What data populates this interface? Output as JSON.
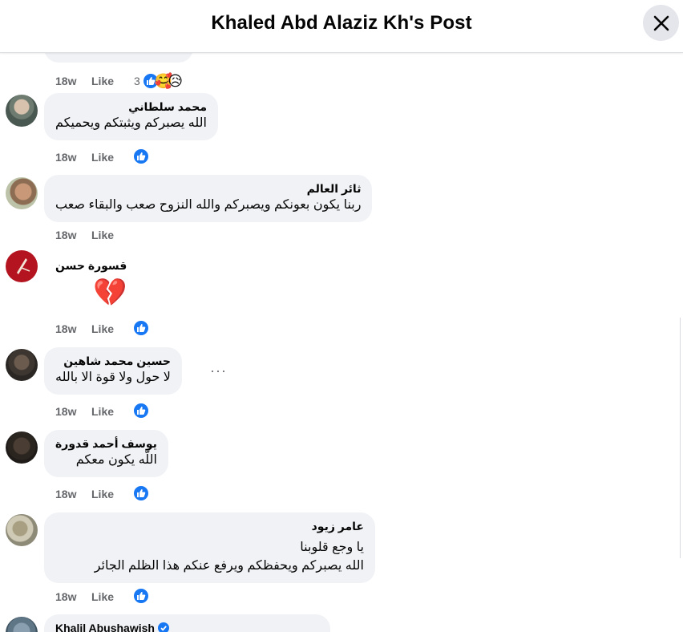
{
  "header": {
    "title": "Khaled Abd Alaziz Kh's Post"
  },
  "colors": {
    "accent": "#1877f2",
    "bubble": "#f0f2f5",
    "muted": "#65676b"
  },
  "top_comment": {
    "time": "18w",
    "like_label": "Like",
    "reaction_count": "3",
    "reactions": [
      "like-icon",
      "care-emoji",
      "sad-emoji"
    ]
  },
  "comments": [
    {
      "author": "محمد سلطاني",
      "text": "الله يصبركم ويثبتكم ويحميكم",
      "time": "18w",
      "like_label": "Like"
    },
    {
      "author": "ثائر العالم",
      "text": "ربنا يكون بعونكم ويصبركم والله النزوح صعب والبقاء صعب",
      "time": "18w",
      "like_label": "Like"
    },
    {
      "author": "قسورة حسن",
      "text": "💔",
      "time": "18w",
      "like_label": "Like"
    },
    {
      "author": "حسين محمد شاهين",
      "text": "لا حول ولا قوة الا بالله",
      "time": "18w",
      "like_label": "Like",
      "more": "···"
    },
    {
      "author": "يوسف أحمد قدورة",
      "text": "اللّه يكون معكم",
      "time": "18w",
      "like_label": "Like"
    },
    {
      "author": "عامر زيود",
      "text_line1": "يا وجع قلوبنا",
      "text_line2": "الله يصبركم ويحفظكم ويرفع عنكم هذا الظلم الجائر",
      "time": "18w",
      "like_label": "Like"
    },
    {
      "author": "Khalil Abushawish"
    }
  ]
}
